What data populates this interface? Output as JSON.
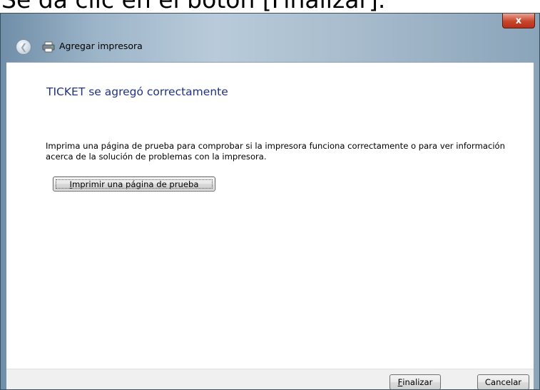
{
  "caption": {
    "text": "Se da clic en el botón [Finalizar]."
  },
  "titlebar": {
    "close_label": "x"
  },
  "navbar": {
    "back_icon": "back-arrow-icon",
    "printer_icon": "printer-icon",
    "title": "Agregar impresora"
  },
  "content": {
    "heading": "TICKET se agregó correctamente",
    "description": "Imprima una página de prueba para comprobar si la impresora funciona correctamente o para ver información acerca de la solución de problemas con la impresora.",
    "test_page_button": {
      "accel": "I",
      "rest": "mprimir una página de prueba"
    }
  },
  "footer": {
    "finish_button": {
      "accel": "F",
      "rest": "inalizar"
    },
    "cancel_button": "Cancelar"
  },
  "colors": {
    "heading": "#1e3287",
    "close_button": "#c7452b",
    "footer_background": "#f0f0f0"
  }
}
